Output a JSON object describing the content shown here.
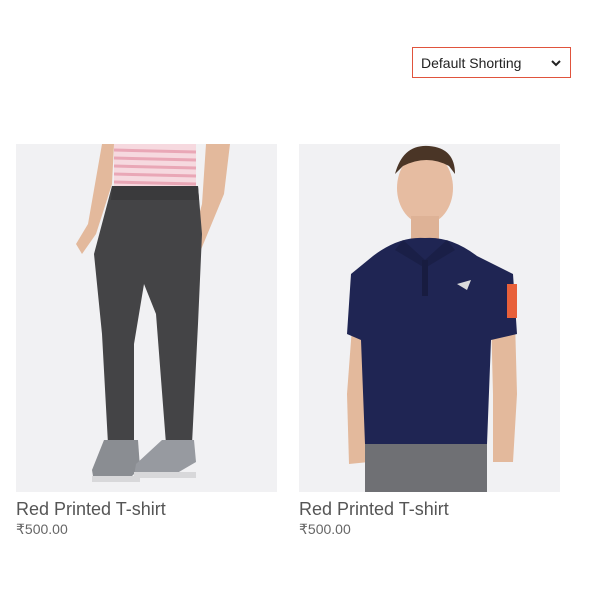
{
  "sort": {
    "selected": "Default Shorting"
  },
  "products": [
    {
      "name": "Red Printed T-shirt",
      "price": "₹500.00",
      "image_icon": "jogger-pants-image"
    },
    {
      "name": "Red Printed T-shirt",
      "price": "₹500.00",
      "image_icon": "polo-tshirt-image"
    }
  ],
  "colors": {
    "select_border": "#e0533d",
    "image_bg": "#f1f1f3",
    "text": "#555555",
    "polo_navy": "#1f2553"
  }
}
